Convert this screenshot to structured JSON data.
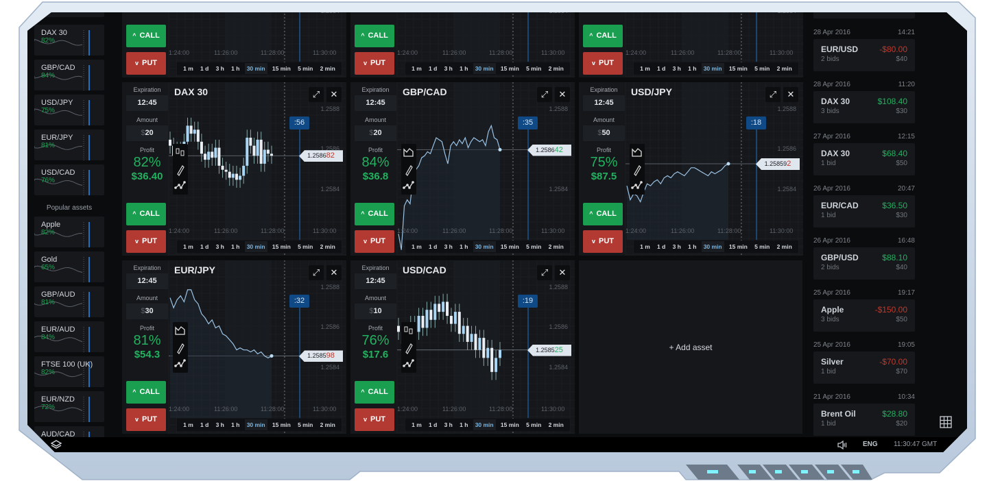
{
  "sidebar": {
    "popular_label": "Popular assets",
    "favorites": [
      {
        "name": "DAX 30",
        "percent": "82%"
      },
      {
        "name": "GBP/CAD",
        "percent": "84%"
      },
      {
        "name": "USD/JPY",
        "percent": "75%"
      },
      {
        "name": "EUR/JPY",
        "percent": "81%"
      },
      {
        "name": "USD/CAD",
        "percent": "76%"
      }
    ],
    "popular": [
      {
        "name": "Apple",
        "percent": "82%"
      },
      {
        "name": "Gold",
        "percent": "65%"
      },
      {
        "name": "GBP/AUD",
        "percent": "81%"
      },
      {
        "name": "EUR/AUD",
        "percent": "84%"
      },
      {
        "name": "FTSE 100 (UK)",
        "percent": "82%"
      },
      {
        "name": "EUR/NZD",
        "percent": "72%"
      },
      {
        "name": "AUD/CAD",
        "percent": ""
      }
    ]
  },
  "labels": {
    "expiration": "Expiration",
    "amount": "Amount",
    "profit": "Profit",
    "currency": "$",
    "call": "CALL",
    "put": "PUT",
    "call_icon": "^",
    "put_icon": "v",
    "add_asset": "+ Add asset"
  },
  "timeframes": [
    "1 m",
    "1 d",
    "3 h",
    "1 h",
    "30 min",
    "15 min",
    "5 min",
    "2 min"
  ],
  "active_timeframe": "30 min",
  "time_ticks": [
    "1:24:00",
    "11:26:00",
    "11:28:00",
    "11:30:00"
  ],
  "price_ticks": [
    "1.2588",
    "1.2586",
    "1.2584"
  ],
  "colors": {
    "call": "#1a9e50",
    "put": "#b23a32",
    "accent": "#0f4a86",
    "up": "#22b25f",
    "down": "#c0392b"
  },
  "top_row_panels": [
    {},
    {},
    {}
  ],
  "panels": [
    {
      "title": "DAX 30",
      "expiration": "12:45",
      "amount": "20",
      "profit_percent": "82%",
      "profit_amount": "$36.40",
      "timer": ":56",
      "price_main": "1.2586",
      "price_tail": "82",
      "tail_dir": "down",
      "style": "candles",
      "series": [
        1.25862,
        1.25857,
        1.2586,
        1.25858,
        1.25864,
        1.25872,
        1.25868,
        1.2587,
        1.25864,
        1.25858,
        1.25855,
        1.25859,
        1.25856,
        1.25861,
        1.25852,
        1.2585,
        1.25849,
        1.25846,
        1.25848,
        1.25845,
        1.25847,
        1.25852,
        1.25866,
        1.25862,
        1.25857,
        1.25865,
        1.25853,
        1.2586,
        1.25858,
        1.25857
      ]
    },
    {
      "title": "GBP/CAD",
      "expiration": "12:45",
      "amount": "20",
      "profit_percent": "84%",
      "profit_amount": "$36.8",
      "timer": ":35",
      "price_main": "1.2586",
      "price_tail": "42",
      "tail_dir": "up",
      "style": "line",
      "series": [
        1.25818,
        1.2581,
        1.25832,
        1.25835,
        1.25833,
        1.25845,
        1.2585,
        1.25852,
        1.25856,
        1.25857,
        1.25859,
        1.25858,
        1.25862,
        1.25866,
        1.25865,
        1.25864,
        1.25858,
        1.25853,
        1.25862,
        1.25864,
        1.25862,
        1.25865,
        1.25863,
        1.25866,
        1.25861,
        1.25864,
        1.25866,
        1.25865,
        1.25864,
        1.25865,
        1.25862,
        1.25869,
        1.25872,
        1.25866,
        1.25865,
        1.2586
      ]
    },
    {
      "title": "USD/JPY",
      "expiration": "12:45",
      "amount": "50",
      "profit_percent": "75%",
      "profit_amount": "$87.5",
      "timer": ":18",
      "price_main": "1.25859",
      "price_tail": "2",
      "tail_dir": "down",
      "style": "line",
      "series": [
        1.25842,
        1.25835,
        1.25838,
        1.25837,
        1.25834,
        1.25839,
        1.25843,
        1.25842,
        1.25844,
        1.25845,
        1.25843,
        1.25846,
        1.25847,
        1.25846,
        1.25848,
        1.25849,
        1.25848,
        1.25847,
        1.25849,
        1.25851,
        1.25851,
        1.2585,
        1.25849,
        1.25848,
        1.25847,
        1.25849,
        1.25848,
        1.25849,
        1.2585,
        1.25852,
        1.25853
      ]
    },
    {
      "title": "EUR/JPY",
      "expiration": "12:45",
      "amount": "30",
      "profit_percent": "81%",
      "profit_amount": "$54.3",
      "timer": ":32",
      "price_main": "1.2585",
      "price_tail": "98",
      "tail_dir": "down",
      "style": "line",
      "series": [
        1.25875,
        1.2587,
        1.25874,
        1.25876,
        1.25873,
        1.25879,
        1.25879,
        1.25874,
        1.25872,
        1.25867,
        1.25865,
        1.25862,
        1.25864,
        1.2586,
        1.25861,
        1.25857,
        1.25856,
        1.25854,
        1.25852,
        1.25849,
        1.2585,
        1.25849,
        1.25849,
        1.25848,
        1.25849,
        1.25847,
        1.25848,
        1.25846,
        1.25845,
        1.25846
      ]
    },
    {
      "title": "USD/CAD",
      "expiration": "12:45",
      "amount": "10",
      "profit_percent": "76%",
      "profit_amount": "$17.6",
      "timer": ":19",
      "price_main": "1.2585",
      "price_tail": "25",
      "tail_dir": "up",
      "style": "candles",
      "series": [
        1.25858,
        1.25852,
        1.25855,
        1.25862,
        1.25858,
        1.25866,
        1.2586,
        1.25869,
        1.25864,
        1.25872,
        1.25868,
        1.25873,
        1.25866,
        1.25862,
        1.25868,
        1.25857,
        1.25861,
        1.25853,
        1.25857,
        1.25849,
        1.25855,
        1.25845,
        1.2585,
        1.25838,
        1.25845,
        1.25849
      ]
    }
  ],
  "trades": [
    {
      "date": "28 Apr 2016",
      "time": "14:21",
      "asset": "EUR/USD",
      "bids": "2 bids",
      "result": "-$80.00",
      "stake": "$40",
      "win": false
    },
    {
      "date": "28 Apr 2016",
      "time": "11:20",
      "asset": "DAX 30",
      "bids": "3 bids",
      "result": "$108.40",
      "stake": "$30",
      "win": true
    },
    {
      "date": "27 Apr 2016",
      "time": "12:15",
      "asset": "DAX 30",
      "bids": "1 bid",
      "result": "$68.40",
      "stake": "$50",
      "win": true
    },
    {
      "date": "26 Apr 2016",
      "time": "20:47",
      "asset": "EUR/CAD",
      "bids": "1 bid",
      "result": "$36.50",
      "stake": "$30",
      "win": true
    },
    {
      "date": "26 Apr 2016",
      "time": "16:48",
      "asset": "GBP/USD",
      "bids": "2 bids",
      "result": "$88.10",
      "stake": "$40",
      "win": true
    },
    {
      "date": "25 Apr 2016",
      "time": "19:17",
      "asset": "Apple",
      "bids": "3 bids",
      "result": "-$150.00",
      "stake": "$50",
      "win": false
    },
    {
      "date": "25 Apr 2016",
      "time": "19:05",
      "asset": "Silver",
      "bids": "1 bid",
      "result": "-$70.00",
      "stake": "$70",
      "win": false
    },
    {
      "date": "21 Apr 2016",
      "time": "10:34",
      "asset": "Brent Oil",
      "bids": "1 bid",
      "result": "$28.80",
      "stake": "$20",
      "win": true
    }
  ],
  "statusbar": {
    "language": "ENG",
    "clock": "11:30:47 GMT",
    "sound_icon": "speaker-icon",
    "layers_icon": "layers-icon",
    "grid_icon": "grid-icon"
  }
}
